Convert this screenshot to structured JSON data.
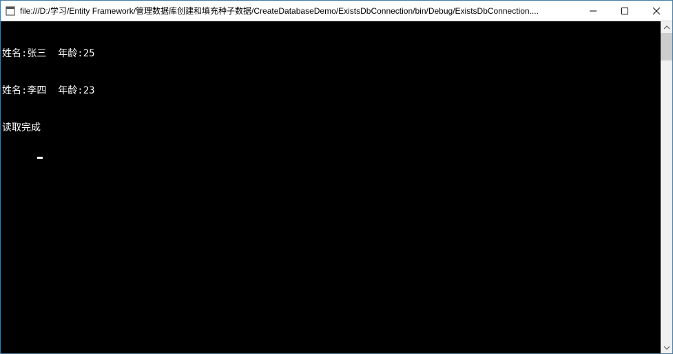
{
  "window": {
    "title": "file:///D:/学习/Entity Framework/管理数据库创建和填充种子数据/CreateDatabaseDemo/ExistsDbConnection/bin/Debug/ExistsDbConnection...."
  },
  "console": {
    "lines": [
      "姓名:张三  年龄:25",
      "姓名:李四  年龄:23",
      "读取完成"
    ]
  }
}
